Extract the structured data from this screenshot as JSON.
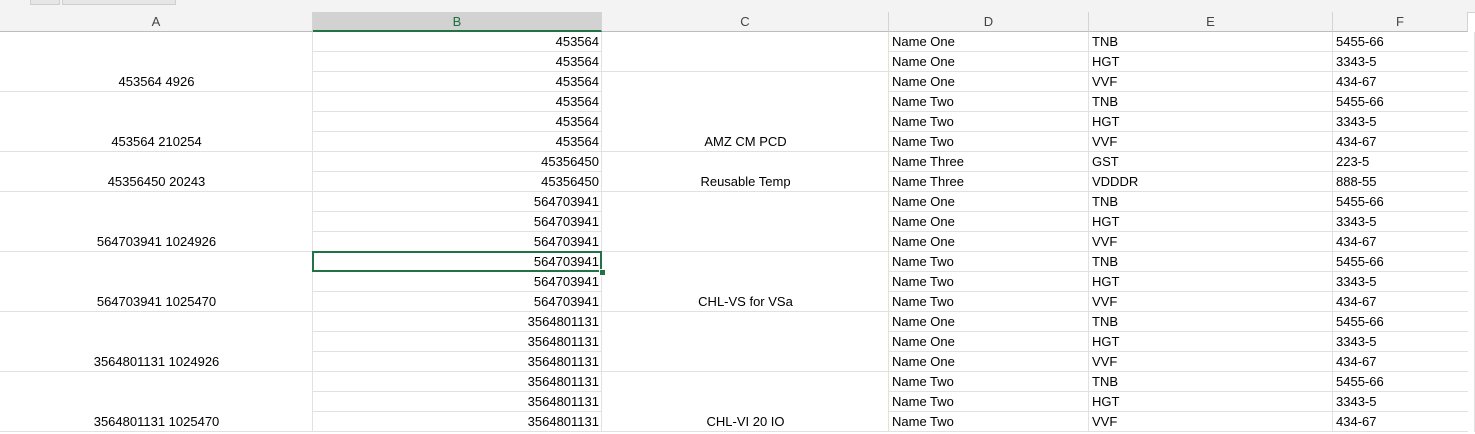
{
  "columns": [
    "A",
    "B",
    "C",
    "D",
    "E",
    "F"
  ],
  "selected_column": "B",
  "selected_cell": {
    "column": "B",
    "row_index": 11
  },
  "rows": [
    {
      "b": "453564",
      "d": "Name One",
      "e": "TNB",
      "f": "5455-66"
    },
    {
      "b": "453564",
      "d": "Name One",
      "e": "HGT",
      "f": "3343-5"
    },
    {
      "b": "453564",
      "d": "Name One",
      "e": "VVF",
      "f": "434-67"
    },
    {
      "b": "453564",
      "d": "Name Two",
      "e": "TNB",
      "f": "5455-66"
    },
    {
      "b": "453564",
      "d": "Name Two",
      "e": "HGT",
      "f": "3343-5"
    },
    {
      "b": "453564",
      "d": "Name Two",
      "e": "VVF",
      "f": "434-67"
    },
    {
      "b": "45356450",
      "d": "Name Three",
      "e": "GST",
      "f": "223-5"
    },
    {
      "b": "45356450",
      "d": "Name Three",
      "e": "VDDDR",
      "f": "888-55"
    },
    {
      "b": "564703941",
      "d": "Name One",
      "e": "TNB",
      "f": "5455-66"
    },
    {
      "b": "564703941",
      "d": "Name One",
      "e": "HGT",
      "f": "3343-5"
    },
    {
      "b": "564703941",
      "d": "Name One",
      "e": "VVF",
      "f": "434-67"
    },
    {
      "b": "564703941",
      "d": "Name Two",
      "e": "TNB",
      "f": "5455-66"
    },
    {
      "b": "564703941",
      "d": "Name Two",
      "e": "HGT",
      "f": "3343-5"
    },
    {
      "b": "564703941",
      "d": "Name Two",
      "e": "VVF",
      "f": "434-67"
    },
    {
      "b": "3564801131",
      "d": "Name One",
      "e": "TNB",
      "f": "5455-66"
    },
    {
      "b": "3564801131",
      "d": "Name One",
      "e": "HGT",
      "f": "3343-5"
    },
    {
      "b": "3564801131",
      "d": "Name One",
      "e": "VVF",
      "f": "434-67"
    },
    {
      "b": "3564801131",
      "d": "Name Two",
      "e": "TNB",
      "f": "5455-66"
    },
    {
      "b": "3564801131",
      "d": "Name Two",
      "e": "HGT",
      "f": "3343-5"
    },
    {
      "b": "3564801131",
      "d": "Name Two",
      "e": "VVF",
      "f": "434-67"
    }
  ],
  "merged_a": [
    {
      "label": "453564 4926",
      "first_row": 0,
      "last_row": 2
    },
    {
      "label": "453564 210254",
      "first_row": 3,
      "last_row": 5
    },
    {
      "label": "45356450 20243",
      "first_row": 6,
      "last_row": 7
    },
    {
      "label": "564703941 1024926",
      "first_row": 8,
      "last_row": 10
    },
    {
      "label": "564703941 1025470",
      "first_row": 11,
      "last_row": 13
    },
    {
      "label": "3564801131 1024926",
      "first_row": 14,
      "last_row": 16
    },
    {
      "label": "3564801131 1025470",
      "first_row": 17,
      "last_row": 19
    }
  ],
  "merged_c": [
    {
      "label": "",
      "first_row": 0,
      "last_row": 1
    },
    {
      "label": "AMZ CM PCD",
      "first_row": 2,
      "last_row": 5
    },
    {
      "label": "Reusable Temp",
      "first_row": 6,
      "last_row": 7
    },
    {
      "label": "",
      "first_row": 8,
      "last_row": 10
    },
    {
      "label": "CHL-VS for VSa",
      "first_row": 11,
      "last_row": 13
    },
    {
      "label": "",
      "first_row": 14,
      "last_row": 16
    },
    {
      "label": "CHL-VI 20 IO",
      "first_row": 17,
      "last_row": 19
    }
  ],
  "colors": {
    "accent": "#217346",
    "grid_line": "#e1e1e1",
    "header_bg": "#f3f3f3"
  }
}
